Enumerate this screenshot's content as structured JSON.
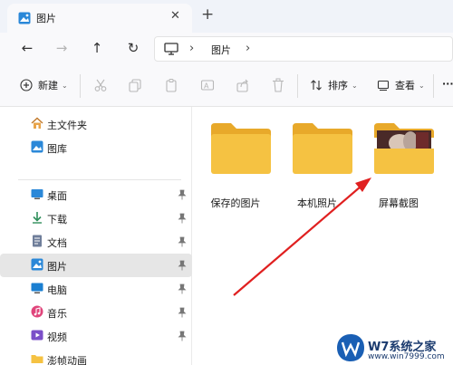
{
  "title_tab": {
    "label": "图片",
    "close": "✕",
    "new_tab": "+"
  },
  "nav": {
    "back": "←",
    "forward": "→",
    "up": "↑",
    "refresh": "↻"
  },
  "address": {
    "separator1": "›",
    "segment": "图片",
    "separator2": "›"
  },
  "toolbar": {
    "new_label": "新建",
    "sort_label": "排序",
    "view_label": "查看",
    "more": "···",
    "caret": "⌄"
  },
  "sidebar": {
    "items": [
      {
        "label": "主文件夹",
        "icon": "home-icon"
      },
      {
        "label": "图库",
        "icon": "gallery-icon"
      },
      {
        "label": "桌面",
        "icon": "desktop-icon",
        "pinned": true
      },
      {
        "label": "下载",
        "icon": "download-icon",
        "pinned": true
      },
      {
        "label": "文档",
        "icon": "document-icon",
        "pinned": true
      },
      {
        "label": "图片",
        "icon": "pictures-icon",
        "pinned": true,
        "selected": true
      },
      {
        "label": "电脑",
        "icon": "computer-icon",
        "pinned": true
      },
      {
        "label": "音乐",
        "icon": "music-icon",
        "pinned": true
      },
      {
        "label": "视频",
        "icon": "video-icon",
        "pinned": true
      },
      {
        "label": "澎帧动画",
        "icon": "folder-icon"
      }
    ]
  },
  "folders": [
    {
      "label": "保存的图片",
      "has_thumbnail": false
    },
    {
      "label": "本机照片",
      "has_thumbnail": false
    },
    {
      "label": "屏幕截图",
      "has_thumbnail": true
    }
  ],
  "watermark": {
    "text": "W7系统之家",
    "url": "www.win7999.com"
  },
  "colors": {
    "folder": "#f5c242",
    "folder_dark": "#e8a92a",
    "accent": "#0067c0",
    "arrow": "#e02020"
  }
}
